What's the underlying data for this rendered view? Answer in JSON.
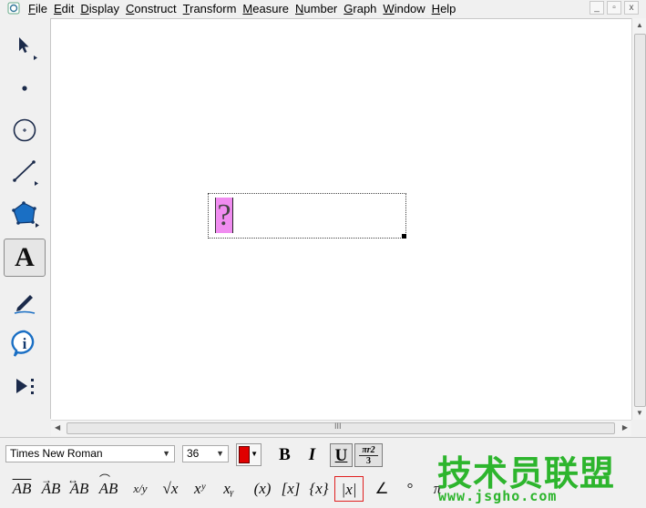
{
  "menubar": {
    "items": [
      "File",
      "Edit",
      "Display",
      "Construct",
      "Transform",
      "Measure",
      "Number",
      "Graph",
      "Window",
      "Help"
    ],
    "window_buttons": [
      "_",
      "▫",
      "x"
    ]
  },
  "toolbox": {
    "tools": [
      "arrow-select-tool",
      "point-tool",
      "compass-tool",
      "straightedge-tool",
      "polygon-tool",
      "text-tool",
      "marker-tool",
      "information-tool",
      "custom-tool"
    ],
    "text_tool_label": "A",
    "info_tool_label": "i",
    "selected": "text-tool"
  },
  "canvas": {
    "textbox_placeholder": "?"
  },
  "hscroll": {
    "grip": "III"
  },
  "text_palette": {
    "font_name": "Times New Roman",
    "font_size": "36",
    "text_color": "#e00000",
    "bold": "B",
    "italic": "I",
    "underline": "U",
    "math_format_top": "πr2",
    "math_format_bottom": "3",
    "math_buttons": [
      "AB",
      "AB",
      "AB",
      "AB",
      "x/y",
      "√x",
      "xʸ",
      "xᵧ",
      "(x)",
      "[x]",
      "{x}",
      "|x|",
      "∠",
      "°",
      "π"
    ],
    "highlighted_button": "|x|"
  },
  "watermark": {
    "chinese": "技术员联盟",
    "url": "www.jsgho.com"
  }
}
